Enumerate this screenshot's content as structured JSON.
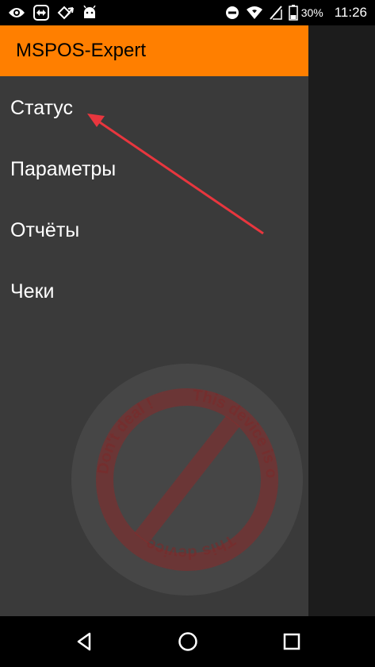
{
  "status_bar": {
    "battery_percent": "30%",
    "time": "11:26",
    "icons": [
      "eye-icon",
      "teamviewer-icon",
      "diamond-arrow-icon",
      "android-icon",
      "do-not-disturb-icon",
      "wifi-icon",
      "no-sim-icon",
      "battery-icon"
    ]
  },
  "app": {
    "title": "MSPOS-Expert",
    "accent_color": "#ff7f00"
  },
  "menu": {
    "items": [
      {
        "label": "Статус"
      },
      {
        "label": "Параметры"
      },
      {
        "label": "Отчёты"
      },
      {
        "label": "Чеки"
      }
    ]
  },
  "watermark": {
    "text_top": "This device is ok",
    "text_side": "Don't deal !",
    "text_bottom": "This device"
  },
  "nav_bar": {
    "buttons": [
      "back-icon",
      "home-icon",
      "recents-icon"
    ]
  }
}
